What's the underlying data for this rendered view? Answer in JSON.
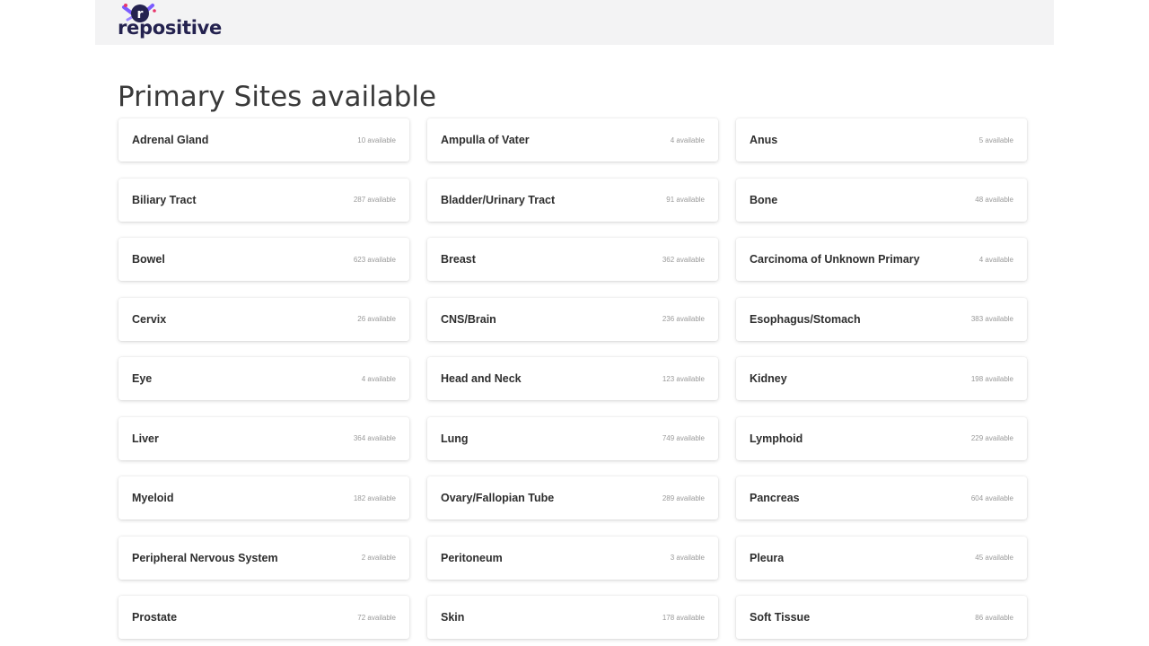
{
  "header": {
    "logo_text": "repositive",
    "logo_mark_letter": "r",
    "brand_color": "#24224f",
    "accent_colors": [
      "#e8356b",
      "#7b5cff"
    ]
  },
  "page_title": "Primary Sites available",
  "sites": [
    {
      "name": "Adrenal Gland",
      "count": "10 available"
    },
    {
      "name": "Ampulla of Vater",
      "count": "4 available"
    },
    {
      "name": "Anus",
      "count": "5 available"
    },
    {
      "name": "Biliary Tract",
      "count": "287 available"
    },
    {
      "name": "Bladder/Urinary Tract",
      "count": "91 available"
    },
    {
      "name": "Bone",
      "count": "48 available"
    },
    {
      "name": "Bowel",
      "count": "623 available"
    },
    {
      "name": "Breast",
      "count": "362 available"
    },
    {
      "name": "Carcinoma of Unknown Primary",
      "count": "4 available"
    },
    {
      "name": "Cervix",
      "count": "26 available"
    },
    {
      "name": "CNS/Brain",
      "count": "236 available"
    },
    {
      "name": "Esophagus/Stomach",
      "count": "383 available"
    },
    {
      "name": "Eye",
      "count": "4 available"
    },
    {
      "name": "Head and Neck",
      "count": "123 available"
    },
    {
      "name": "Kidney",
      "count": "198 available"
    },
    {
      "name": "Liver",
      "count": "364 available"
    },
    {
      "name": "Lung",
      "count": "749 available"
    },
    {
      "name": "Lymphoid",
      "count": "229 available"
    },
    {
      "name": "Myeloid",
      "count": "182 available"
    },
    {
      "name": "Ovary/Fallopian Tube",
      "count": "289 available"
    },
    {
      "name": "Pancreas",
      "count": "604 available"
    },
    {
      "name": "Peripheral Nervous System",
      "count": "2 available"
    },
    {
      "name": "Peritoneum",
      "count": "3 available"
    },
    {
      "name": "Pleura",
      "count": "45 available"
    },
    {
      "name": "Prostate",
      "count": "72 available"
    },
    {
      "name": "Skin",
      "count": "178 available"
    },
    {
      "name": "Soft Tissue",
      "count": "86 available"
    }
  ]
}
